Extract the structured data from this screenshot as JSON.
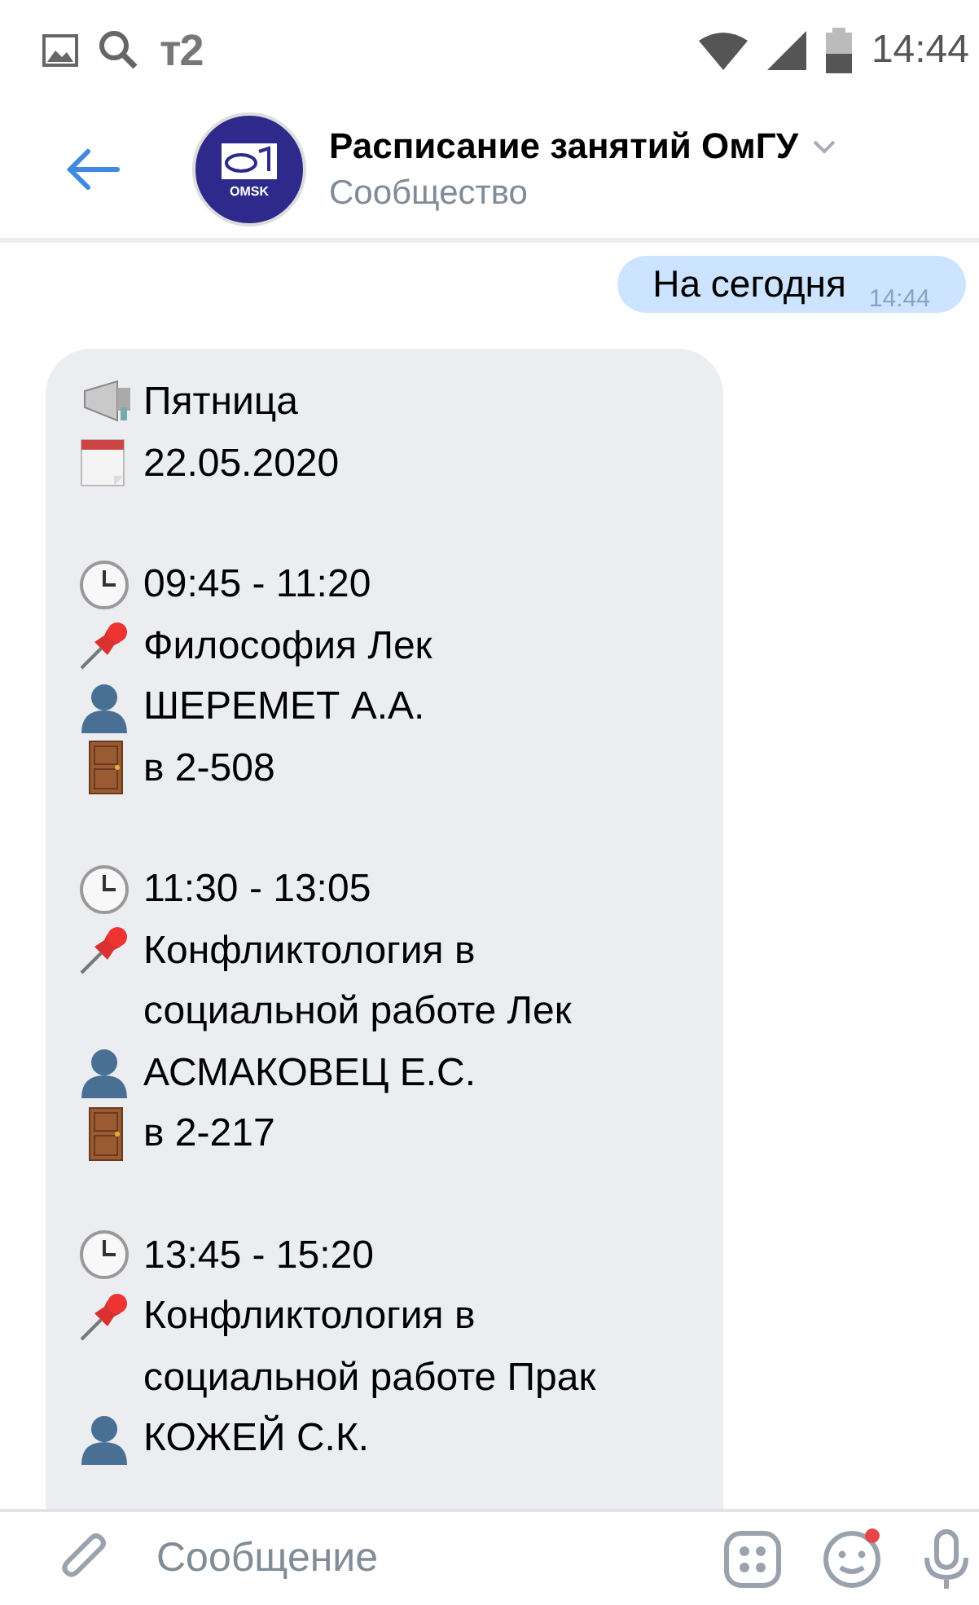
{
  "status_bar": {
    "carrier": "т2",
    "time": "14:44"
  },
  "header": {
    "title": "Расписание занятий ОмГУ",
    "subtitle": "Сообщество",
    "logo_text": "OMSK"
  },
  "messages": [
    {
      "kind": "outgoing",
      "text": "На сегодня",
      "time": "14:44"
    },
    {
      "kind": "incoming",
      "groups": [
        [
          {
            "kind": "megaphone",
            "text": "Пятница"
          },
          {
            "kind": "calendar",
            "text": "22.05.2020"
          }
        ],
        [
          {
            "kind": "clock",
            "text": "09:45 - 11:20"
          },
          {
            "kind": "pin",
            "text": "Философия Лек"
          },
          {
            "kind": "person",
            "text": "ШЕРЕМЕТ А.А."
          },
          {
            "kind": "door",
            "text": "в 2-508"
          }
        ],
        [
          {
            "kind": "clock",
            "text": "11:30 - 13:05"
          },
          {
            "kind": "pin",
            "text": "Конфликтология в социальной работе Лек"
          },
          {
            "kind": "person",
            "text": "АСМАКОВЕЦ Е.С."
          },
          {
            "kind": "door",
            "text": "в 2-217"
          }
        ],
        [
          {
            "kind": "clock",
            "text": "13:45 - 15:20"
          },
          {
            "kind": "pin",
            "text": "Конфликтология в социальной работе Прак"
          },
          {
            "kind": "person",
            "text": "КОЖЕЙ С.К."
          }
        ]
      ]
    }
  ],
  "composer": {
    "placeholder": "Сообщение",
    "emoji_badge": true
  }
}
